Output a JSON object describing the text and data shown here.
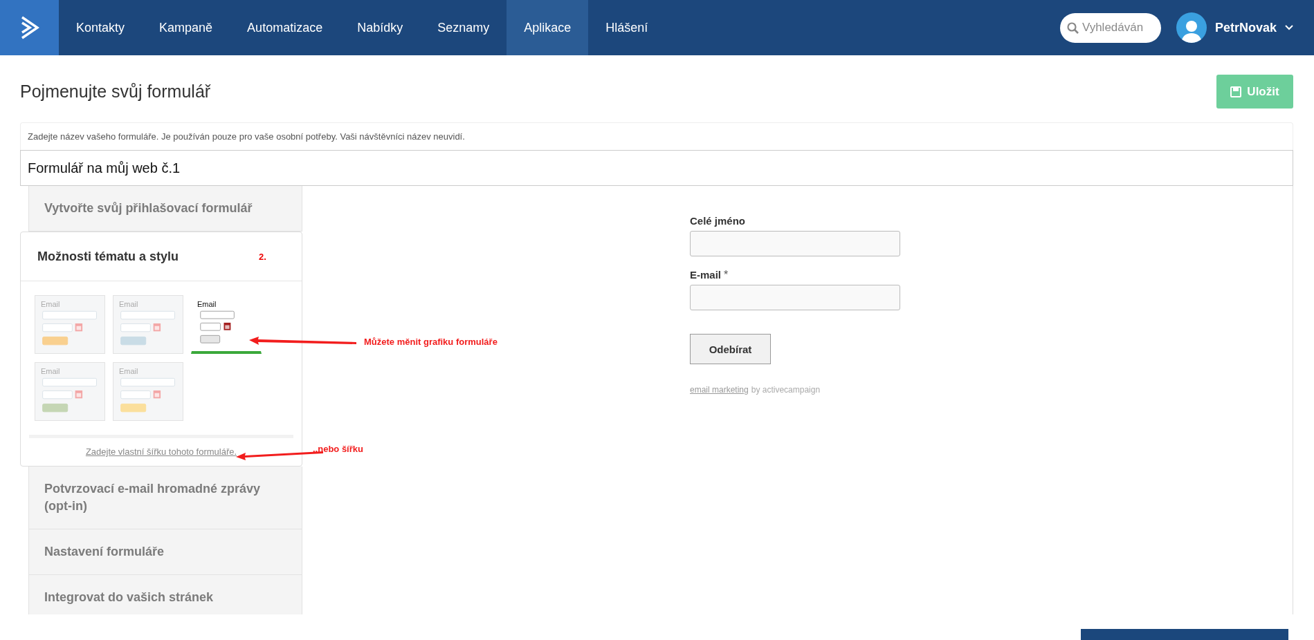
{
  "nav": {
    "items": [
      {
        "label": "Kontakty",
        "selected": false
      },
      {
        "label": "Kampaně",
        "selected": false
      },
      {
        "label": "Automatizace",
        "selected": false
      },
      {
        "label": "Nabídky",
        "selected": false
      },
      {
        "label": "Seznamy",
        "selected": false
      },
      {
        "label": "Aplikace",
        "selected": true
      },
      {
        "label": "Hlášení",
        "selected": false
      }
    ],
    "search": {
      "placeholder": "Vyhledáván"
    },
    "user": {
      "name": "PetrNovak"
    }
  },
  "page": {
    "title": "Pojmenujte svůj formulář",
    "save_button": "Uložit",
    "name_hint": "Zadejte název vašeho formuláře. Je používán pouze pro vaše osobní potřeby. Vaši návštěvníci název neuvidí.",
    "name_value": "Formulář na můj web č.1"
  },
  "steps": [
    {
      "label": "Vytvořte svůj přihlašovací formulář",
      "expanded": false
    },
    {
      "label": "Možnosti tématu a stylu",
      "expanded": true,
      "note": "2.",
      "themes": [
        {
          "label": "Email",
          "color": "#f9d08f",
          "selected": false
        },
        {
          "label": "Email",
          "color": "#c9dce6",
          "selected": false
        },
        {
          "label": "Email",
          "color": "#e6e6e6",
          "selected": true
        },
        {
          "label": "Email",
          "color": "#c5d6b4",
          "selected": false
        },
        {
          "label": "Email",
          "color": "#fbdf9c",
          "selected": false
        }
      ],
      "link": "Zadejte vlastní šířku tohoto formuláře."
    },
    {
      "label": "Potvrzovací e-mail hromadné zprávy (opt-in)",
      "expanded": false
    },
    {
      "label": "Nastavení formuláře",
      "expanded": false
    },
    {
      "label": "Integrovat do vašich stránek",
      "expanded": false
    }
  ],
  "annotations": [
    {
      "text": "Můžete měnit grafiku formuláře"
    },
    {
      "text": "..nebo šířku"
    }
  ],
  "preview": {
    "fields": [
      {
        "label": "Celé jméno"
      },
      {
        "label": "E-mail",
        "required_mark": "*"
      }
    ],
    "submit": "Odebírat",
    "footer_link": "email marketing",
    "footer_text": "by activecampaign"
  }
}
